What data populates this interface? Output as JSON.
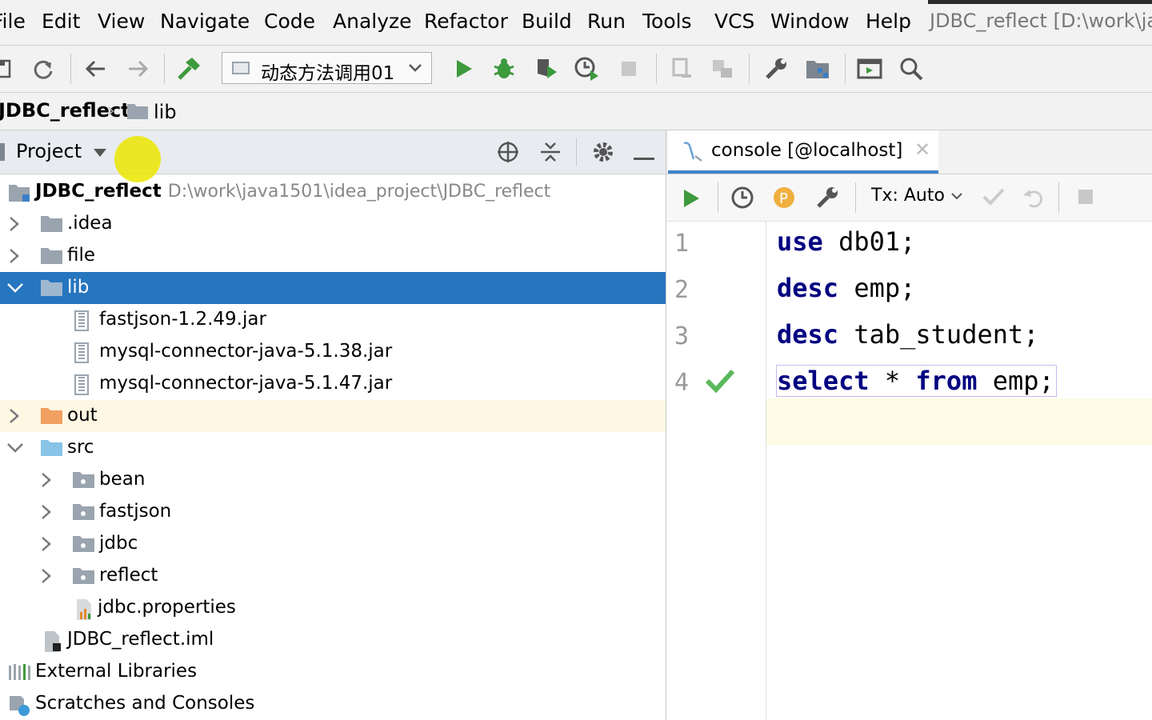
{
  "menubar": {
    "items": [
      "File",
      "Edit",
      "View",
      "Navigate",
      "Code",
      "Analyze",
      "Refactor",
      "Build",
      "Run",
      "Tools",
      "VCS",
      "Window",
      "Help"
    ],
    "title": "JDBC_reflect [D:\\work\\ja"
  },
  "toolbar": {
    "run_config": "动态方法调用01"
  },
  "breadcrumb": {
    "project": "JDBC_reflect",
    "folder": "lib"
  },
  "project_panel": {
    "label": "Project",
    "root": {
      "name": "JDBC_reflect",
      "path": "D:\\work\\java1501\\idea_project\\JDBC_reflect"
    },
    "items": [
      {
        "name": ".idea"
      },
      {
        "name": "file"
      },
      {
        "name": "lib"
      },
      {
        "name": "fastjson-1.2.49.jar"
      },
      {
        "name": "mysql-connector-java-5.1.38.jar"
      },
      {
        "name": "mysql-connector-java-5.1.47.jar"
      },
      {
        "name": "out"
      },
      {
        "name": "src"
      },
      {
        "name": "bean"
      },
      {
        "name": "fastjson"
      },
      {
        "name": "jdbc"
      },
      {
        "name": "reflect"
      },
      {
        "name": "jdbc.properties"
      },
      {
        "name": "JDBC_reflect.iml"
      },
      {
        "name": "External Libraries"
      },
      {
        "name": "Scratches and Consoles"
      }
    ]
  },
  "editor": {
    "tab_label": "console [@localhost]",
    "tx_mode": "Tx: Auto",
    "lines": [
      {
        "num": "1",
        "kw": "use",
        "rest": " db01;"
      },
      {
        "num": "2",
        "kw": "desc",
        "rest": " emp;"
      },
      {
        "num": "3",
        "kw": "desc",
        "rest": " tab_student;"
      },
      {
        "num": "4",
        "kw": "select",
        "mid": " * ",
        "kw2": "from",
        "rest": " emp;"
      }
    ]
  },
  "colors": {
    "selection": "#2675bf",
    "keyword": "#000080",
    "run_green": "#3d9a3d"
  }
}
